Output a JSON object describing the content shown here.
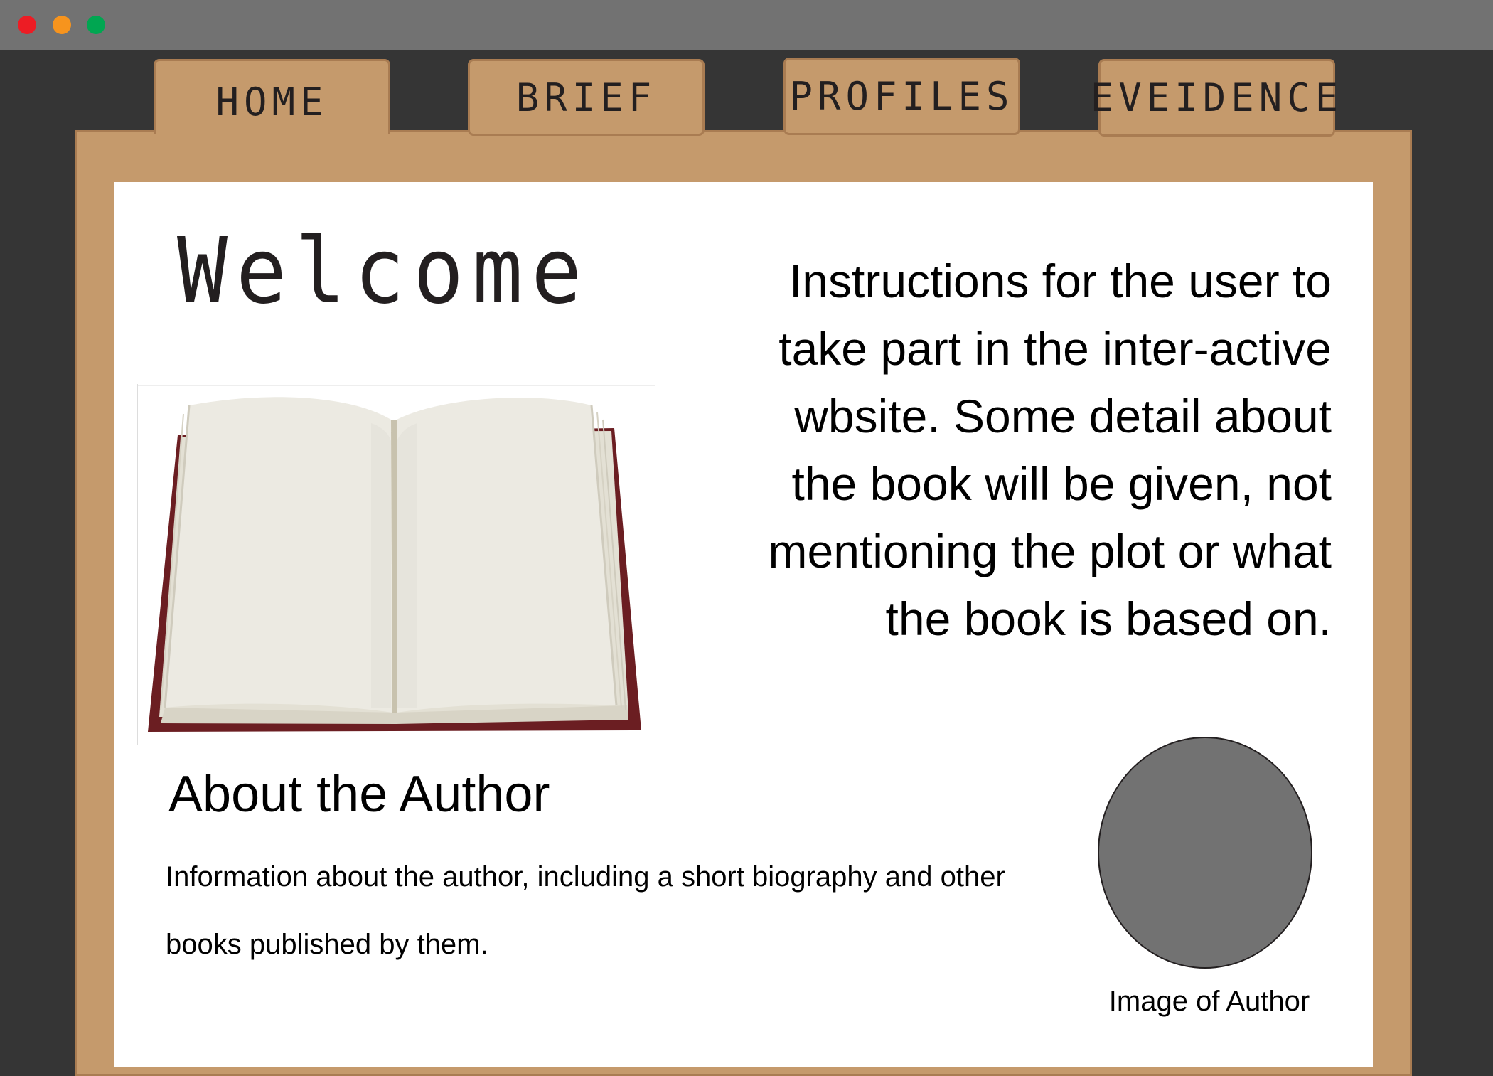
{
  "window": {
    "controls": [
      "close",
      "minimize",
      "maximize"
    ],
    "colors": {
      "close": "#ed1c24",
      "minimize": "#f7941d",
      "maximize": "#00a651",
      "titlebar": "#727272"
    }
  },
  "tabs": [
    {
      "label": "HOME",
      "active": true
    },
    {
      "label": "BRIEF",
      "active": false
    },
    {
      "label": "PROFILES",
      "active": false
    },
    {
      "label": "EVEIDENCE",
      "active": false
    }
  ],
  "theme": {
    "folder_color": "#c59a6c",
    "folder_border": "#a97c52",
    "background": "#353535"
  },
  "main": {
    "welcome": "Welcome",
    "instructions": "Instructions for the user to take part in the inter-active wbsite. Some detail about the book will be given, not mentioning the plot or what the book is based on.",
    "book_image_icon": "open-book-image"
  },
  "author": {
    "heading": "About the Author",
    "description": "Information about the author, including a short biography and other books published by them.",
    "image_caption": "Image of Author",
    "image_placeholder_color": "#727272"
  }
}
